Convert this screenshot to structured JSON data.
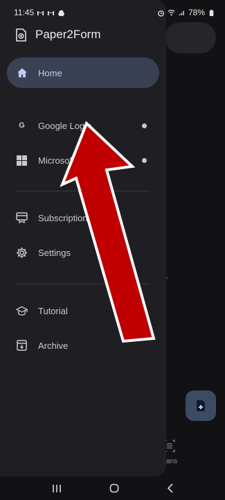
{
  "status_bar": {
    "time": "11:45",
    "battery": "78%"
  },
  "drawer": {
    "app_title": "Paper2Form",
    "items": [
      {
        "label": "Home",
        "icon": "home-icon"
      },
      {
        "label": "Google Login",
        "icon": "google-icon",
        "badge_char": "G"
      },
      {
        "label": "Microsoft",
        "icon": "microsoft-icon"
      },
      {
        "label": "Subscription",
        "icon": "subscription-icon"
      },
      {
        "label": "Settings",
        "icon": "gear-icon"
      },
      {
        "label": "Tutorial",
        "icon": "graduation-cap-icon"
      },
      {
        "label": "Archive",
        "icon": "archive-icon"
      }
    ]
  },
  "background": {
    "nav_label": "ans"
  },
  "colors": {
    "active_item_bg": "#3a4152",
    "active_item_text": "#b9cdf8",
    "annotation_arrow": "#c00000"
  }
}
